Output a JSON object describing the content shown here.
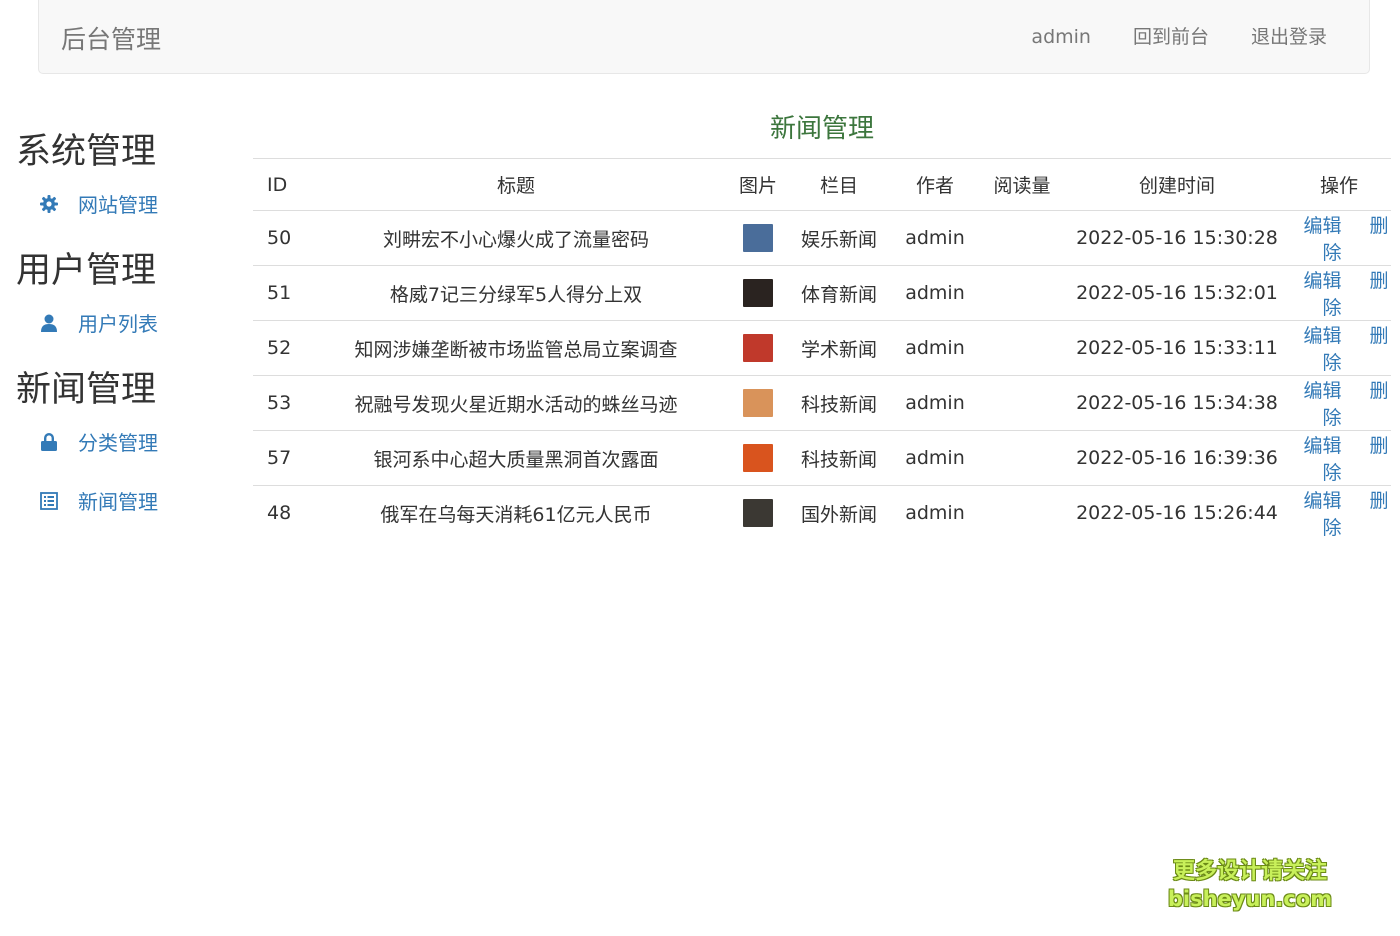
{
  "navbar": {
    "brand": "后台管理",
    "links": [
      "admin",
      "回到前台",
      "退出登录"
    ]
  },
  "sidebar": {
    "groups": [
      {
        "title": "系统管理",
        "items": [
          {
            "label": "网站管理",
            "icon": "gear-icon"
          }
        ]
      },
      {
        "title": "用户管理",
        "items": [
          {
            "label": "用户列表",
            "icon": "user-icon"
          }
        ]
      },
      {
        "title": "新闻管理",
        "items": [
          {
            "label": "分类管理",
            "icon": "lock-icon"
          },
          {
            "label": "新闻管理",
            "icon": "list-icon"
          }
        ]
      }
    ]
  },
  "main": {
    "title": "新闻管理",
    "columns": [
      "ID",
      "标题",
      "图片",
      "栏目",
      "作者",
      "阅读量",
      "创建时间",
      "操作"
    ],
    "rows": [
      {
        "id": "50",
        "title": "刘畊宏不小心爆火成了流量密码",
        "category": "娱乐新闻",
        "author": "admin",
        "reads": "",
        "created": "2022-05-16 15:30:28",
        "thumb_color": "#4a6d9a",
        "edit": "编辑",
        "delete": "删除"
      },
      {
        "id": "51",
        "title": "格威7记三分绿军5人得分上双",
        "category": "体育新闻",
        "author": "admin",
        "reads": "",
        "created": "2022-05-16 15:32:01",
        "thumb_color": "#2a2320",
        "edit": "编辑",
        "delete": "删除"
      },
      {
        "id": "52",
        "title": "知网涉嫌垄断被市场监管总局立案调查",
        "category": "学术新闻",
        "author": "admin",
        "reads": "",
        "created": "2022-05-16 15:33:11",
        "thumb_color": "#c0392b",
        "edit": "编辑",
        "delete": "删除"
      },
      {
        "id": "53",
        "title": "祝融号发现火星近期水活动的蛛丝马迹",
        "category": "科技新闻",
        "author": "admin",
        "reads": "",
        "created": "2022-05-16 15:34:38",
        "thumb_color": "#d9935a",
        "edit": "编辑",
        "delete": "删除"
      },
      {
        "id": "57",
        "title": "银河系中心超大质量黑洞首次露面",
        "category": "科技新闻",
        "author": "admin",
        "reads": "",
        "created": "2022-05-16 16:39:36",
        "thumb_color": "#d9541e",
        "edit": "编辑",
        "delete": "删除"
      },
      {
        "id": "48",
        "title": "俄军在乌每天消耗61亿元人民币",
        "category": "国外新闻",
        "author": "admin",
        "reads": "",
        "created": "2022-05-16 15:26:44",
        "thumb_color": "#3b3833",
        "edit": "编辑",
        "delete": "删除"
      }
    ]
  },
  "watermark": {
    "line1": "更多设计请关注",
    "line2": "bisheyun.com"
  },
  "colors": {
    "link": "#337ab7",
    "title_green": "#3c763d",
    "nav_bg": "#f8f8f8"
  }
}
